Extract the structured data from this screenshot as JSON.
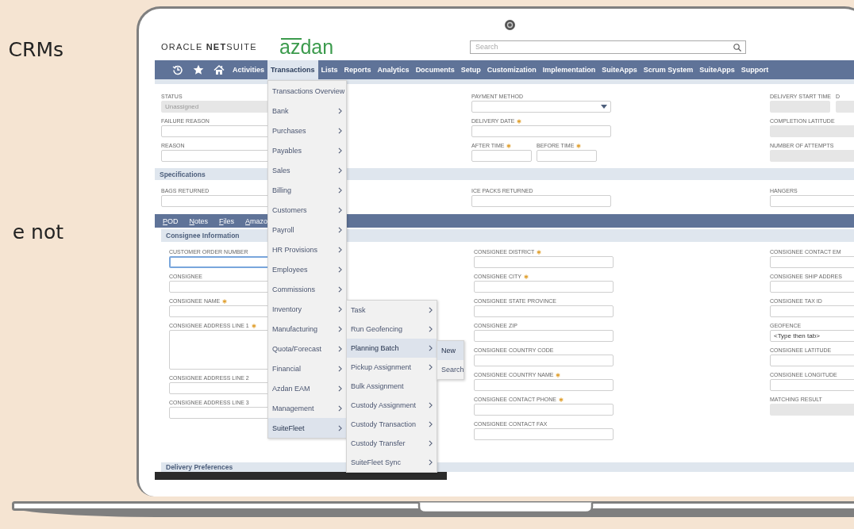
{
  "background_text": [
    "CRMs",
    "e not"
  ],
  "header": {
    "brand": "ORACLE **NET**SUITE",
    "logo": "azdan",
    "search": {
      "placeholder": "Search"
    }
  },
  "nav": {
    "items": [
      {
        "label": "Activities",
        "selected": false
      },
      {
        "label": "Transactions",
        "selected": true
      },
      {
        "label": "Lists",
        "selected": false
      },
      {
        "label": "Reports",
        "selected": false
      },
      {
        "label": "Analytics",
        "selected": false
      },
      {
        "label": "Documents",
        "selected": false
      },
      {
        "label": "Setup",
        "selected": false
      },
      {
        "label": "Customization",
        "selected": false
      },
      {
        "label": "Implementation",
        "selected": false
      },
      {
        "label": "SuiteApps",
        "selected": false
      },
      {
        "label": "Scrum System",
        "selected": false
      },
      {
        "label": "SuiteApps",
        "selected": false
      },
      {
        "label": "Support",
        "selected": false
      }
    ]
  },
  "delivery": {
    "columns": [
      [
        {
          "label": "STATUS",
          "kind": "readonly",
          "value": "Unassigned"
        },
        {
          "label": "FAILURE REASON",
          "kind": "text"
        },
        {
          "label": "REASON",
          "kind": "text"
        }
      ],
      [
        {
          "label": "PAYMENT METHOD",
          "kind": "select"
        },
        {
          "label": "DELIVERY DATE",
          "kind": "text",
          "required": true
        },
        {
          "kind": "group",
          "fields": [
            {
              "label": "AFTER TIME",
              "kind": "text",
              "required": true
            },
            {
              "label": "BEFORE TIME",
              "kind": "text",
              "required": true
            }
          ]
        }
      ],
      [
        {
          "kind": "group",
          "fields": [
            {
              "label": "DELIVERY START TIME",
              "kind": "readonly"
            },
            {
              "label": "D",
              "kind": "readonly"
            }
          ]
        },
        {
          "label": "COMPLETION LATITUDE",
          "kind": "readonly"
        },
        {
          "label": "NUMBER OF ATTEMPTS",
          "kind": "readonly"
        }
      ]
    ]
  },
  "specifications": {
    "title": "Specifications",
    "columns": [
      [
        {
          "label": "BAGS RETURNED",
          "kind": "text"
        }
      ],
      [
        {
          "label": "ICE PACKS RETURNED",
          "kind": "text"
        }
      ],
      [
        {
          "label": "HANGERS",
          "kind": "text"
        }
      ]
    ]
  },
  "subtabs": [
    {
      "label": "POD"
    },
    {
      "label": "Notes"
    },
    {
      "label": "Files"
    },
    {
      "label": "Amazo"
    }
  ],
  "consignee": {
    "title": "Consignee Information",
    "columns": [
      [
        {
          "label": "CUSTOMER ORDER NUMBER",
          "kind": "text",
          "focused": true
        },
        {
          "label": "CONSIGNEE",
          "kind": "text"
        },
        {
          "label": "CONSIGNEE NAME",
          "kind": "text",
          "required": true
        },
        {
          "label": "CONSIGNEE ADDRESS LINE 1",
          "kind": "textarea",
          "required": true
        },
        {
          "label": "CONSIGNEE ADDRESS LINE 2",
          "kind": "text"
        },
        {
          "label": "CONSIGNEE ADDRESS LINE 3",
          "kind": "text"
        }
      ],
      [
        {
          "label": "CONSIGNEE DISTRICT",
          "kind": "text",
          "required": true
        },
        {
          "label": "CONSIGNEE CITY",
          "kind": "text",
          "required": true
        },
        {
          "label": "CONSIGNEE STATE PROVINCE",
          "kind": "text"
        },
        {
          "label": "CONSIGNEE ZIP",
          "kind": "text"
        },
        {
          "label": "CONSIGNEE COUNTRY CODE",
          "kind": "text"
        },
        {
          "label": "CONSIGNEE COUNTRY NAME",
          "kind": "text",
          "required": true
        },
        {
          "label": "CONSIGNEE CONTACT PHONE",
          "kind": "text",
          "required": true
        },
        {
          "label": "CONSIGNEE CONTACT FAX",
          "kind": "text"
        }
      ],
      [
        {
          "label": "CONSIGNEE CONTACT EM",
          "kind": "text"
        },
        {
          "label": "CONSIGNEE SHIP ADDRES",
          "kind": "text"
        },
        {
          "label": "CONSIGNEE TAX ID",
          "kind": "text"
        },
        {
          "label": "GEOFENCE",
          "kind": "text",
          "value": "<Type then tab>"
        },
        {
          "label": "CONSIGNEE LATITUDE",
          "kind": "text"
        },
        {
          "label": "CONSIGNEE LONGITUDE",
          "kind": "text"
        },
        {
          "label": "MATCHING RESULT",
          "kind": "readonly"
        }
      ]
    ]
  },
  "next_section": {
    "title": "Delivery Preferences"
  },
  "menus": [
    {
      "items": [
        {
          "label": "Transactions Overview",
          "submenu": false,
          "selected": false
        },
        {
          "label": "Bank",
          "submenu": true,
          "selected": false
        },
        {
          "label": "Purchases",
          "submenu": true,
          "selected": false
        },
        {
          "label": "Payables",
          "submenu": true,
          "selected": false
        },
        {
          "label": "Sales",
          "submenu": true,
          "selected": false
        },
        {
          "label": "Billing",
          "submenu": true,
          "selected": false
        },
        {
          "label": "Customers",
          "submenu": true,
          "selected": false
        },
        {
          "label": "Payroll",
          "submenu": true,
          "selected": false
        },
        {
          "label": "HR Provisions",
          "submenu": true,
          "selected": false
        },
        {
          "label": "Employees",
          "submenu": true,
          "selected": false
        },
        {
          "label": "Commissions",
          "submenu": true,
          "selected": false
        },
        {
          "label": "Inventory",
          "submenu": true,
          "selected": false
        },
        {
          "label": "Manufacturing",
          "submenu": true,
          "selected": false
        },
        {
          "label": "Quota/Forecast",
          "submenu": true,
          "selected": false
        },
        {
          "label": "Financial",
          "submenu": true,
          "selected": false
        },
        {
          "label": "Azdan EAM",
          "submenu": true,
          "selected": false
        },
        {
          "label": "Management",
          "submenu": true,
          "selected": false
        },
        {
          "label": "SuiteFleet",
          "submenu": true,
          "selected": true
        }
      ]
    },
    {
      "items": [
        {
          "label": "Task",
          "submenu": true,
          "selected": false
        },
        {
          "label": "Run Geofencing",
          "submenu": true,
          "selected": false
        },
        {
          "label": "Planning Batch",
          "submenu": true,
          "selected": true
        },
        {
          "label": "Pickup Assignment",
          "submenu": true,
          "selected": false
        },
        {
          "label": "Bulk Assignment",
          "submenu": false,
          "selected": false
        },
        {
          "label": "Custody Assignment",
          "submenu": true,
          "selected": false
        },
        {
          "label": "Custody Transaction",
          "submenu": true,
          "selected": false
        },
        {
          "label": "Custody Transfer",
          "submenu": true,
          "selected": false
        },
        {
          "label": "SuiteFleet Sync",
          "submenu": true,
          "selected": false
        }
      ]
    },
    {
      "items": [
        {
          "label": "New",
          "submenu": false,
          "selected": true
        },
        {
          "label": "Search",
          "submenu": false,
          "selected": false
        }
      ]
    }
  ]
}
